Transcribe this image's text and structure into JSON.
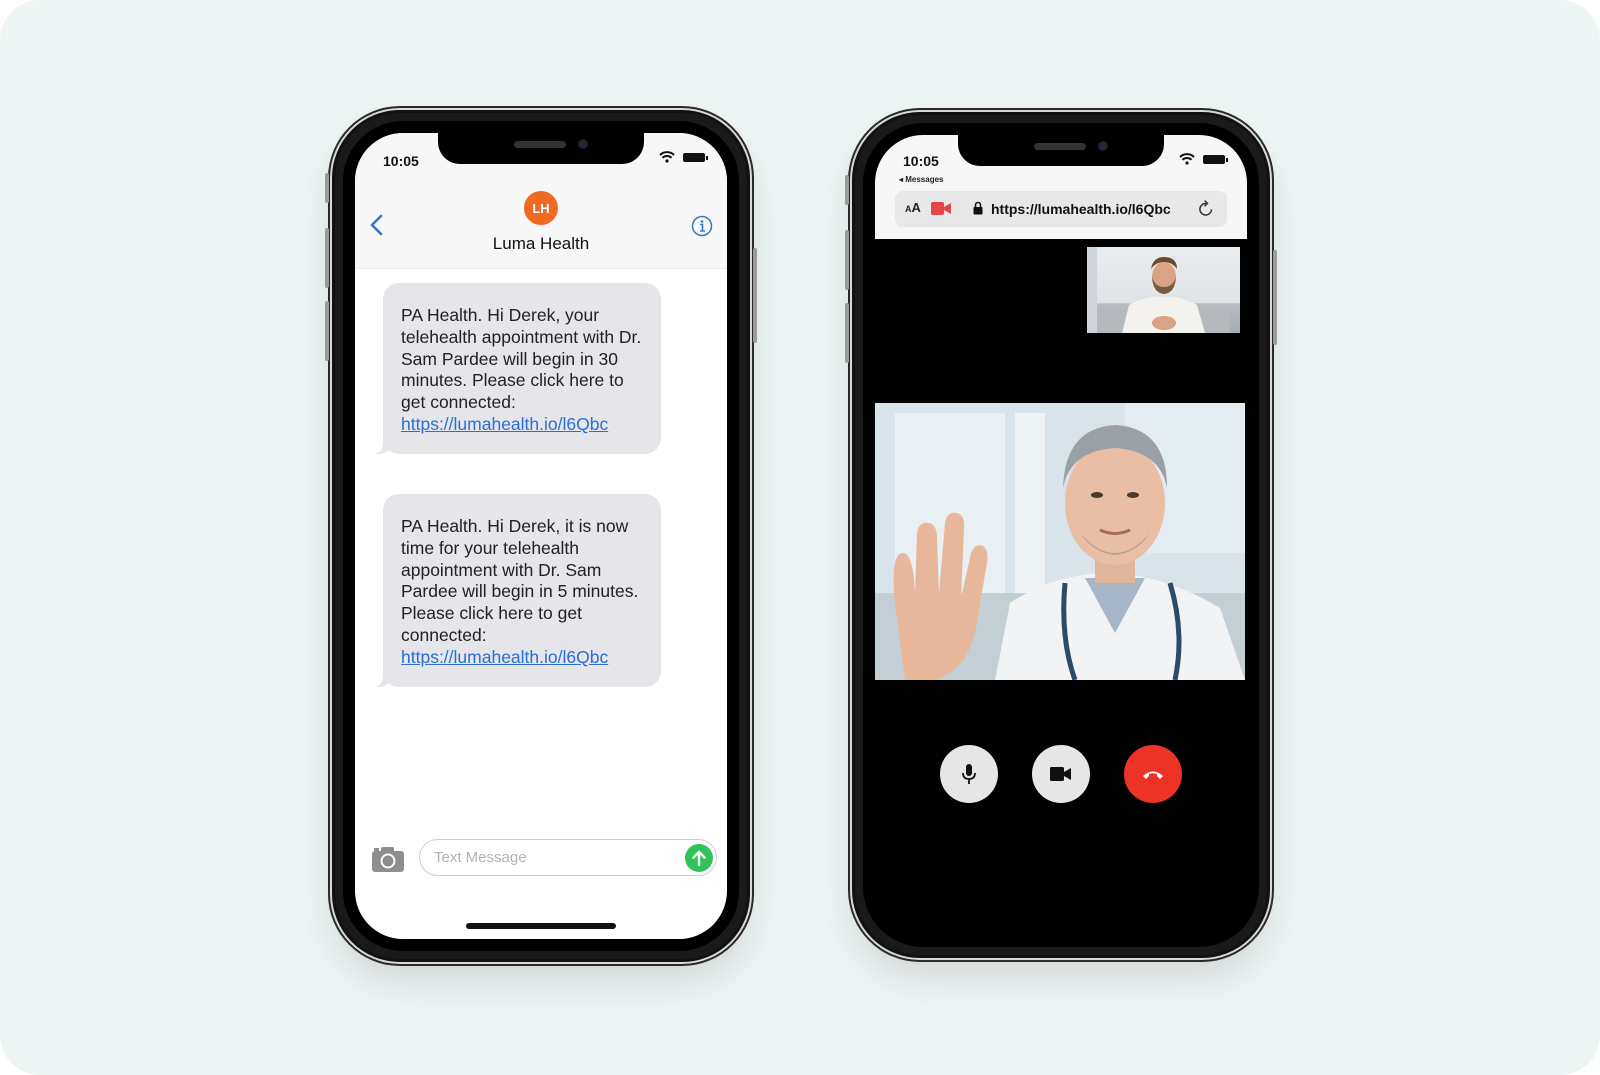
{
  "messages_phone": {
    "status_time": "10:05",
    "contact": {
      "initials": "LH",
      "name": "Luma Health",
      "avatar_color": "#f06a23"
    },
    "icons": {
      "back": "chevron-left-icon",
      "info": "info-icon",
      "camera": "camera-icon",
      "send": "arrow-up-icon"
    },
    "messages": [
      {
        "text": "PA Health. Hi Derek, your telehealth appointment with Dr. Sam Pardee will begin in 30 minutes. Please click here to get connected:",
        "link": "https://lumahealth.io/l6Qbc"
      },
      {
        "text": "PA Health. Hi Derek, it is now time for your telehealth appointment with Dr. Sam Pardee will begin in 5 minutes. Please click here to get connected:",
        "link": "https://lumahealth.io/l6Qbc"
      }
    ],
    "compose": {
      "placeholder": "Text Message",
      "value": ""
    },
    "accent_color": "#2a6fd6",
    "send_color": "#30c35a"
  },
  "video_phone": {
    "status_time": "10:05",
    "back_label": "◂ Messages",
    "browser": {
      "text_size_label_small": "A",
      "text_size_label_large": "A",
      "url": "https://lumahealth.io/l6Qbc"
    },
    "participants": {
      "self": "patient-video",
      "remote": "doctor-video"
    },
    "controls": [
      {
        "name": "mute",
        "icon": "microphone-icon"
      },
      {
        "name": "camera",
        "icon": "video-camera-icon"
      },
      {
        "name": "end-call",
        "icon": "phone-hangup-icon",
        "color": "#ec3325"
      }
    ]
  }
}
